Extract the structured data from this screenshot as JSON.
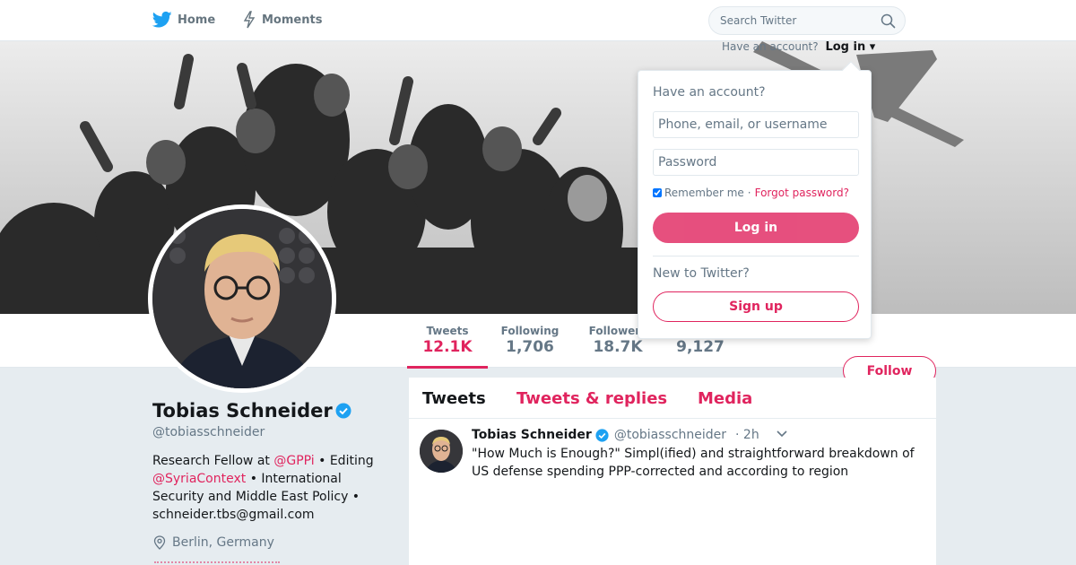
{
  "topnav": {
    "home_label": "Home",
    "moments_label": "Moments",
    "search_placeholder": "Search Twitter",
    "icons": [
      "twitter-bird-icon",
      "lightning-icon",
      "search-icon"
    ]
  },
  "login_hint": {
    "question": "Have an account?",
    "login_label": "Log in"
  },
  "login_dropdown": {
    "title": "Have an account?",
    "username_placeholder": "Phone, email, or username",
    "password_placeholder": "Password",
    "remember_label": "Remember me",
    "separator": "·",
    "forgot_label": "Forgot password?",
    "login_button": "Log in",
    "new_label": "New to Twitter?",
    "signup_button": "Sign up"
  },
  "stats": [
    {
      "label": "Tweets",
      "value": "12.1K",
      "active": true
    },
    {
      "label": "Following",
      "value": "1,706"
    },
    {
      "label": "Followers",
      "value": "18.7K"
    },
    {
      "label": "",
      "value": "9,127"
    }
  ],
  "follow_button": "Follow",
  "profile": {
    "name": "Tobias Schneider",
    "handle": "@tobiasschneider",
    "bio_prefix": "Research Fellow at ",
    "bio_link1": "@GPPi",
    "bio_mid": " • Editing ",
    "bio_link2": "@SyriaContext",
    "bio_suffix": " • International Security and Middle East Policy • schneider.tbs@gmail.com",
    "location": "Berlin, Germany"
  },
  "timeline": {
    "tabs": [
      "Tweets",
      "Tweets & replies",
      "Media"
    ],
    "tweet": {
      "name": "Tobias Schneider",
      "handle": "@tobiasschneider",
      "time": "· 2h",
      "text": "\"How Much is Enough?\" Simpl(ified) and straightforward breakdown of US defense spending PPP-corrected and according to region"
    }
  },
  "colors": {
    "accent": "#e0245e",
    "verified": "#1da1f2",
    "twitter_blue": "#1da1f2"
  }
}
